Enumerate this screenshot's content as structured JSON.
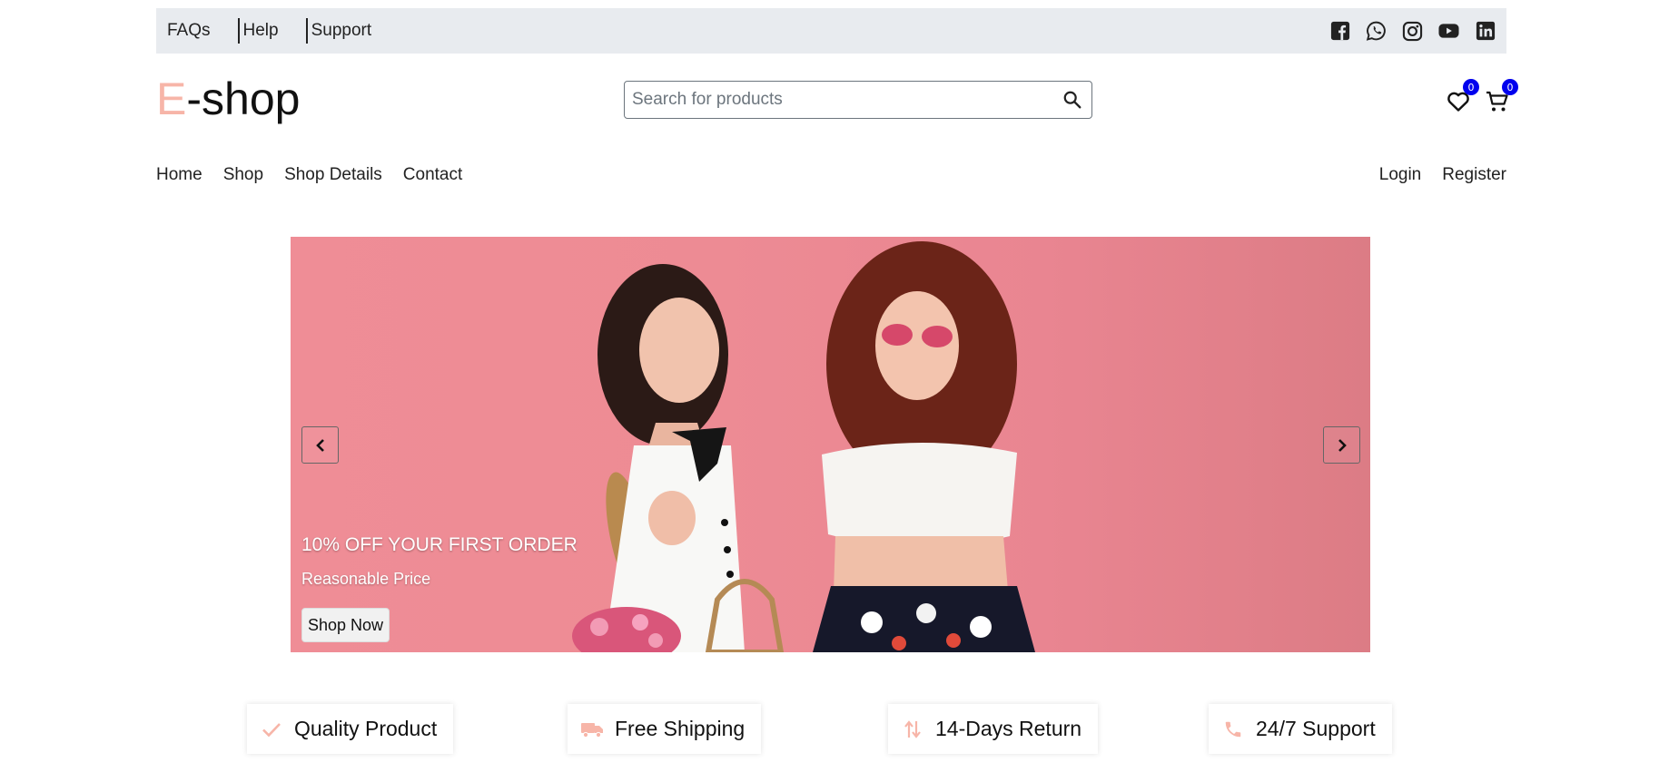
{
  "topbar": {
    "links": [
      "FAQs",
      "Help",
      "Support"
    ],
    "social_icons": [
      "facebook-icon",
      "whatsapp-icon",
      "instagram-icon",
      "youtube-icon",
      "linkedin-icon"
    ]
  },
  "header": {
    "logo_first": "E",
    "logo_rest": "-shop",
    "search_placeholder": "Search for products",
    "wishlist_count": "0",
    "cart_count": "0"
  },
  "nav": {
    "left": [
      "Home",
      "Shop",
      "Shop Details",
      "Contact"
    ],
    "right": [
      "Login",
      "Register"
    ]
  },
  "hero": {
    "title": "10% OFF YOUR FIRST ORDER",
    "subtitle": "Reasonable Price",
    "button": "Shop Now"
  },
  "features": [
    {
      "label": "Quality Product",
      "icon": "check-icon"
    },
    {
      "label": "Free Shipping",
      "icon": "truck-icon"
    },
    {
      "label": "14-Days Return",
      "icon": "exchange-icon"
    },
    {
      "label": "24/7 Support",
      "icon": "phone-icon"
    }
  ],
  "colors": {
    "accent": "#f7b5a8",
    "topbar_bg": "#e8ebef",
    "hero_bg": "#ed8b94",
    "badge": "#0000ee"
  }
}
